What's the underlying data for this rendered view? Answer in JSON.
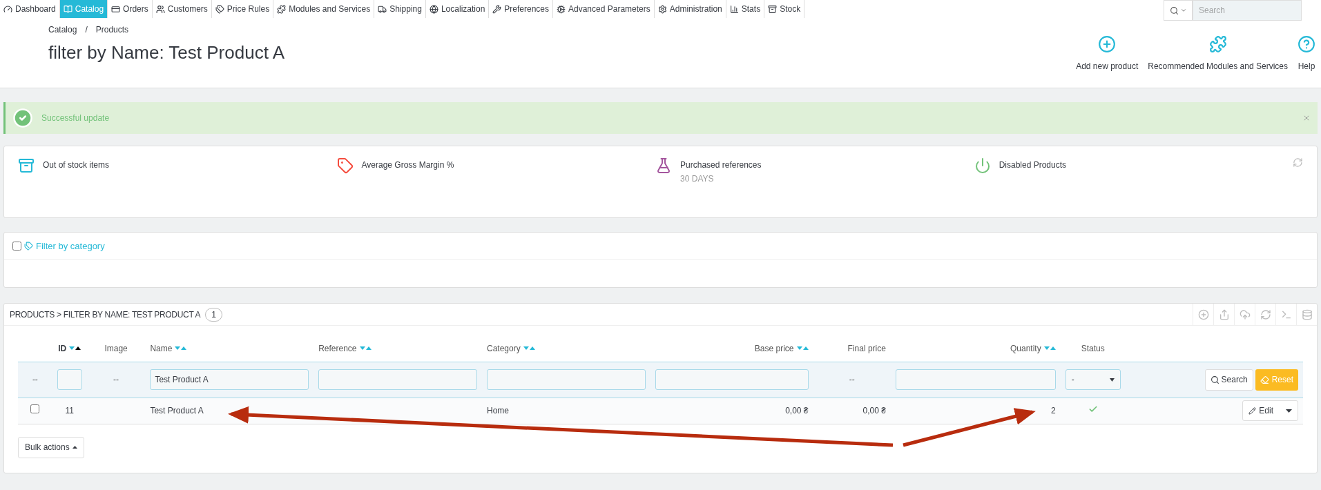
{
  "nav": {
    "items": [
      {
        "label": "Dashboard",
        "selected": false
      },
      {
        "label": "Catalog",
        "selected": true
      },
      {
        "label": "Orders",
        "selected": false
      },
      {
        "label": "Customers",
        "selected": false
      },
      {
        "label": "Price Rules",
        "selected": false
      },
      {
        "label": "Modules and Services",
        "selected": false
      },
      {
        "label": "Shipping",
        "selected": false
      },
      {
        "label": "Localization",
        "selected": false
      },
      {
        "label": "Preferences",
        "selected": false
      },
      {
        "label": "Advanced Parameters",
        "selected": false
      },
      {
        "label": "Administration",
        "selected": false
      },
      {
        "label": "Stats",
        "selected": false
      },
      {
        "label": "Stock",
        "selected": false
      }
    ],
    "search": {
      "placeholder": "Search"
    }
  },
  "header": {
    "breadcrumb": [
      "Catalog",
      "Products"
    ],
    "breadcrumb_separator": "/",
    "title": "filter by Name: Test Product A",
    "toolbar": [
      {
        "label": "Add new product"
      },
      {
        "label": "Recommended Modules and Services"
      },
      {
        "label": "Help"
      }
    ]
  },
  "alert": {
    "message": "Successful update"
  },
  "kpis": [
    {
      "label": "Out of stock items"
    },
    {
      "label": "Average Gross Margin %"
    },
    {
      "label": "Purchased references",
      "sublabel": "30 DAYS"
    },
    {
      "label": "Disabled Products"
    }
  ],
  "category_filter": {
    "label": "Filter by category",
    "checked": false
  },
  "table": {
    "title": "PRODUCTS > FILTER BY NAME: TEST PRODUCT A",
    "count": "1",
    "columns": [
      {
        "label": "ID",
        "sortable": true,
        "sorted": true
      },
      {
        "label": "Image",
        "sortable": false,
        "sorted": false
      },
      {
        "label": "Name",
        "sortable": true,
        "sorted": false
      },
      {
        "label": "Reference",
        "sortable": true,
        "sorted": false
      },
      {
        "label": "Category",
        "sortable": true,
        "sorted": false
      },
      {
        "label": "Base price",
        "sortable": true,
        "sorted": false
      },
      {
        "label": "Final price",
        "sortable": false,
        "sorted": false
      },
      {
        "label": "Quantity",
        "sortable": true,
        "sorted": false
      },
      {
        "label": "Status",
        "sortable": false,
        "sorted": false
      }
    ],
    "filters": [
      {
        "kind": "dash",
        "text": "--"
      },
      {
        "kind": "input"
      },
      {
        "kind": "dash",
        "text": "--"
      },
      {
        "kind": "input",
        "value": "Test Product A"
      },
      {
        "kind": "input"
      },
      {
        "kind": "input"
      },
      {
        "kind": "input"
      },
      {
        "kind": "dash",
        "text": "--"
      },
      {
        "kind": "input"
      },
      {
        "kind": "select",
        "value": "-"
      }
    ],
    "filter_buttons": [
      "Search",
      "Reset"
    ],
    "rows": [
      {
        "checked": false,
        "id": "11",
        "name": "Test Product A",
        "category": "Home",
        "base_price": "0,00 ₴",
        "final_price": "0,00 ₴",
        "quantity": "2",
        "enabled": true,
        "action": "Edit"
      }
    ],
    "bulk_actions": "Bulk actions"
  }
}
